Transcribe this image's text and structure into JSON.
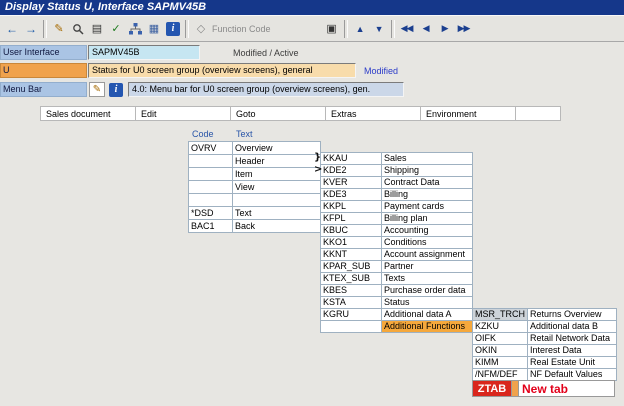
{
  "window": {
    "title": "Display Status U, Interface SAPMV45B"
  },
  "toolbar": {
    "function_code_label": "Function Code",
    "icons": [
      {
        "name": "back-icon",
        "glyph": "←"
      },
      {
        "name": "forward-icon",
        "glyph": "→"
      },
      {
        "name": "display-change-icon",
        "glyph": "✎"
      },
      {
        "name": "search-icon",
        "glyph": ""
      },
      {
        "name": "copy-icon",
        "glyph": "▤"
      },
      {
        "name": "check-icon",
        "glyph": "✓"
      },
      {
        "name": "hierarchy-icon",
        "glyph": ""
      },
      {
        "name": "table-icon",
        "glyph": "▦"
      },
      {
        "name": "info-icon",
        "glyph": "i"
      },
      {
        "name": "function-code-icon",
        "glyph": "◇"
      },
      {
        "name": "print-icon",
        "glyph": "▣"
      },
      {
        "name": "sort-up-icon",
        "glyph": "▲"
      },
      {
        "name": "sort-down-icon",
        "glyph": "▼"
      },
      {
        "name": "first-status-icon",
        "glyph": "◀◀"
      },
      {
        "name": "previous-status-icon",
        "glyph": "◀"
      },
      {
        "name": "next-status-icon",
        "glyph": "▶"
      },
      {
        "name": "last-status-icon",
        "glyph": "▶▶"
      }
    ]
  },
  "form": {
    "user_interface": {
      "label": "User Interface",
      "value": "SAPMV45B",
      "state": "Modified / Active"
    },
    "status": {
      "name": "U",
      "description": "Status for U0 screen group (overview screens), general",
      "state": "Modified"
    },
    "menu_bar": {
      "label": "Menu Bar",
      "description": "4.0: Menu bar for U0 screen group (overview screens), gen."
    }
  },
  "menubar": {
    "items": [
      {
        "label": "Sales document"
      },
      {
        "label": "Edit"
      },
      {
        "label": "Goto"
      },
      {
        "label": "Extras"
      },
      {
        "label": "Environment"
      }
    ]
  },
  "tables": {
    "headers": {
      "code": "Code",
      "text": "Text"
    },
    "menu1": {
      "rows": [
        {
          "code": "OVRV",
          "text": "Overview"
        },
        {
          "code": "",
          "text": "Header"
        },
        {
          "code": "",
          "text": "Item"
        },
        {
          "code": "",
          "text": "View"
        },
        {
          "code": "",
          "text": ""
        },
        {
          "code": "*DSD",
          "text": "Text"
        },
        {
          "code": "BAC1",
          "text": "Back"
        }
      ]
    },
    "menu2": {
      "rows": [
        {
          "prefix": "}",
          "code": "KKAU",
          "text": "Sales"
        },
        {
          "prefix": ">",
          "code": "KDE2",
          "text": "Shipping"
        },
        {
          "code": "KVER",
          "text": "Contract Data"
        },
        {
          "code": "KDE3",
          "text": "Billing"
        },
        {
          "code": "KKPL",
          "text": "Payment cards"
        },
        {
          "code": "KFPL",
          "text": "Billing plan"
        },
        {
          "code": "KBUC",
          "text": "Accounting"
        },
        {
          "code": "KKO1",
          "text": "Conditions"
        },
        {
          "code": "KKNT",
          "text": "Account assignment"
        },
        {
          "code": "KPAR_SUB",
          "text": "Partner"
        },
        {
          "code": "KTEX_SUB",
          "text": "Texts"
        },
        {
          "code": "KBES",
          "text": "Purchase order data"
        },
        {
          "code": "KSTA",
          "text": "Status"
        },
        {
          "code": "KGRU",
          "text": "Additional data A"
        },
        {
          "code": "",
          "text": "Additional Functions",
          "text_cls": "hl"
        }
      ]
    },
    "menu3": {
      "rows": [
        {
          "code": "MSR_TRCH",
          "text": "Returns Overview",
          "code_cls": "sel"
        },
        {
          "code": "KZKU",
          "text": "Additional data B"
        },
        {
          "code": "OIFK",
          "text": "Retail Network Data"
        },
        {
          "code": "OKIN",
          "text": "Interest Data"
        },
        {
          "code": "KIMM",
          "text": "Real Estate Unit"
        },
        {
          "code": "/NFM/DEF",
          "text": "NF Default Values"
        }
      ],
      "ztab": {
        "code": "ZTAB",
        "text": "New tab"
      }
    }
  },
  "colors": {
    "titlebar_blue": "#15378a",
    "highlight_orange": "#f5a83c",
    "ztab_red": "#d9261c",
    "new_tab_red": "#e2001a"
  }
}
